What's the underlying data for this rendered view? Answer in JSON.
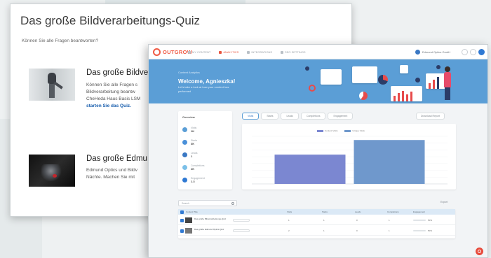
{
  "quiz_page": {
    "title": "Das große Bildverarbeitungs-Quiz",
    "subtitle": "Können Sie alle Fragen beantworten?",
    "items": [
      {
        "title": "Das große Bildve",
        "lines": [
          "Können Sie alle Fragen s",
          "Bildverarbeitung beantw",
          "CheHeda Haus Basis LSM"
        ],
        "link": "starten Sie das Quiz."
      },
      {
        "title": "Das große Edmu",
        "lines": [
          "Edmund Optics und Bildv",
          "Nächte. Machen Sie mit"
        ],
        "link": ""
      }
    ]
  },
  "dashboard": {
    "logo": "OUTGROW",
    "nav": [
      {
        "label": "MY CONTENT",
        "active": false
      },
      {
        "label": "ANALYTICS",
        "active": true
      },
      {
        "label": "INTEGRATIONS",
        "active": false
      },
      {
        "label": "SEO SETTINGS",
        "active": false
      }
    ],
    "user_name": "Edmund Optics GmbH",
    "hero": {
      "crumb": "Content Analytics",
      "title": "Welcome, Agnieszka!",
      "subtitle": "Let's take a look at how your content has performed"
    },
    "overview": {
      "title": "Overview",
      "stats": [
        {
          "label": "Visits",
          "value": "1K",
          "color": "#5b9ed6"
        },
        {
          "label": "Starts",
          "value": "3K",
          "color": "#4a90d9"
        },
        {
          "label": "Leads",
          "value": "1",
          "color": "#3a78c4"
        },
        {
          "label": "Completions",
          "value": "2K",
          "color": "#7cc0e8"
        },
        {
          "label": "Engagement",
          "value": "1.3",
          "color": "#2f79d3"
        }
      ]
    },
    "tabs": [
      {
        "label": "Visits",
        "active": true
      },
      {
        "label": "Starts",
        "active": false
      },
      {
        "label": "Leads",
        "active": false
      },
      {
        "label": "Completions",
        "active": false
      },
      {
        "label": "Engagement",
        "active": false
      }
    ],
    "download_label": "Download Report",
    "search_placeholder": "Search",
    "export_label": "Export",
    "table": {
      "headers": [
        "Content Title",
        "Visits",
        "Starts",
        "Leads",
        "Completions",
        "Engagement"
      ],
      "rows": [
        {
          "title": "Das große Bildverarbeitungs-Quiz",
          "visits": "1",
          "starts": "1",
          "leads": "0",
          "completions": "1",
          "engagement": 0.5,
          "engagement_label": "50%"
        },
        {
          "title": "Das große Edmund Optics Quiz",
          "visits": "2",
          "starts": "1",
          "leads": "0",
          "completions": "1",
          "engagement": 0.5,
          "engagement_label": "50%"
        }
      ]
    }
  },
  "chart_data": {
    "type": "bar",
    "categories": [
      ""
    ],
    "series": [
      {
        "name": "Content Visits",
        "values": [
          8
        ],
        "color": "#7b87d1"
      },
      {
        "name": "Unique Visits",
        "values": [
          12
        ],
        "color": "#6f98cc"
      }
    ],
    "ylim": [
      0,
      13
    ],
    "yticks": [
      "",
      "",
      "",
      "",
      "",
      "",
      "",
      ""
    ],
    "xticks": [
      ""
    ],
    "title": "",
    "xlabel": "",
    "ylabel": ""
  },
  "colors": {
    "accent": "#e8553f",
    "hero_bg": "#5b9ed6",
    "primary_blue": "#2f79d3"
  }
}
